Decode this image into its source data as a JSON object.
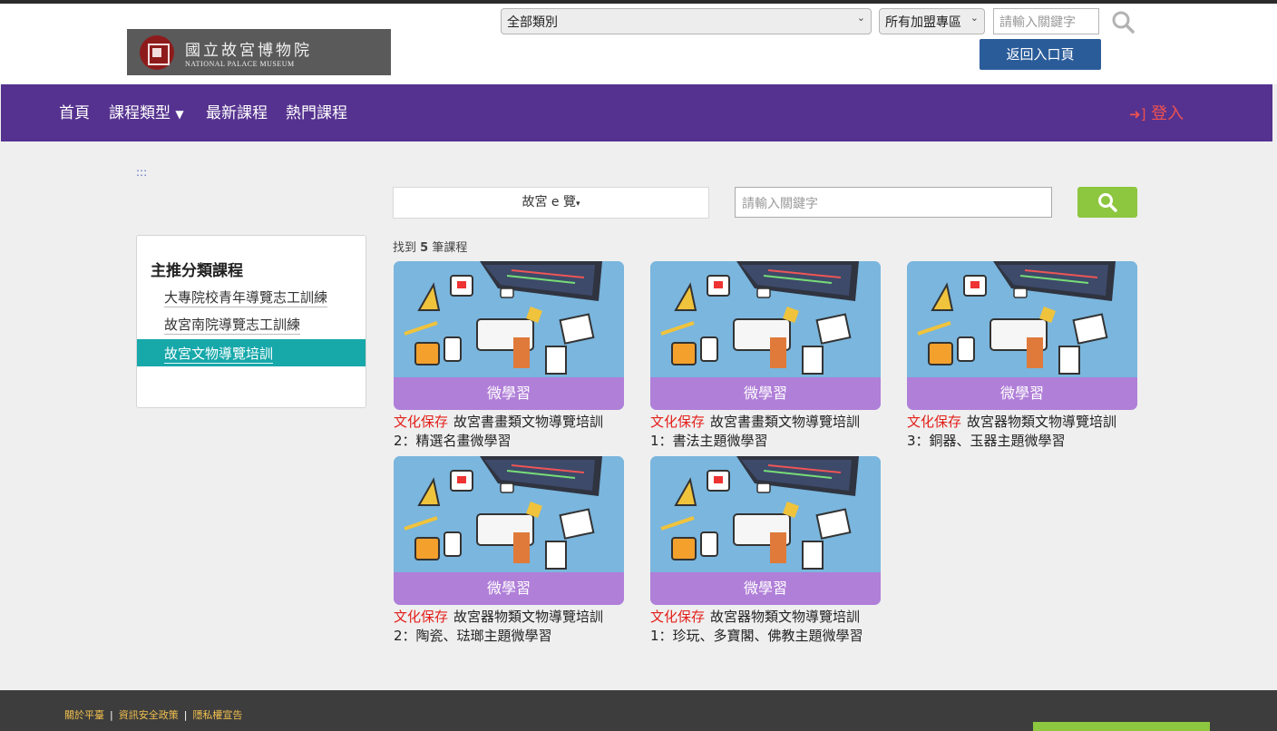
{
  "header": {
    "logo": {
      "zh": "國立故宮博物院",
      "en": "NATIONAL PALACE MUSEUM"
    },
    "category_select": "全部類別",
    "zone_select": "所有加盟專區",
    "keyword_placeholder": "請輸入關鍵字",
    "back_button": "返回入口頁"
  },
  "nav": {
    "items": [
      "首頁",
      "課程類型",
      "最新課程",
      "熱門課程"
    ],
    "login": "登入"
  },
  "breadcrumb_dots": ":::",
  "search": {
    "category_dropdown": "故宮 e 覽",
    "keyword_placeholder": "請輸入關鍵字"
  },
  "sidebar": {
    "title": "主推分類課程",
    "items": [
      {
        "label": "大專院校青年導覽志工訓練",
        "active": false
      },
      {
        "label": "故宮南院導覽志工訓練",
        "active": false
      },
      {
        "label": "故宮文物導覽培訓",
        "active": true
      }
    ]
  },
  "results": {
    "prefix": "找到",
    "count": "5",
    "suffix": "筆課程"
  },
  "courses": [
    {
      "badge": "微學習",
      "tag": "文化保存",
      "title": "故宮書畫類文物導覽培訓2：精選名畫微學習"
    },
    {
      "badge": "微學習",
      "tag": "文化保存",
      "title": "故宮書畫類文物導覽培訓1：書法主題微學習"
    },
    {
      "badge": "微學習",
      "tag": "文化保存",
      "title": "故宮器物類文物導覽培訓3：銅器、玉器主題微學習"
    },
    {
      "badge": "微學習",
      "tag": "文化保存",
      "title": "故宮器物類文物導覽培訓2：陶瓷、琺瑯主題微學習"
    },
    {
      "badge": "微學習",
      "tag": "文化保存",
      "title": "故宮器物類文物導覽培訓1：珍玩、多寶閣、佛教主題微學習"
    }
  ],
  "footer": {
    "links": [
      "關於平臺",
      "資訊安全政策",
      "隱私權宣告"
    ]
  },
  "colors": {
    "nav_bg": "#55328f",
    "badge_band": "#b07fd8",
    "active_sidebar": "#17a8aa",
    "tag_red": "#e3201b",
    "search_green": "#8dc63f"
  }
}
